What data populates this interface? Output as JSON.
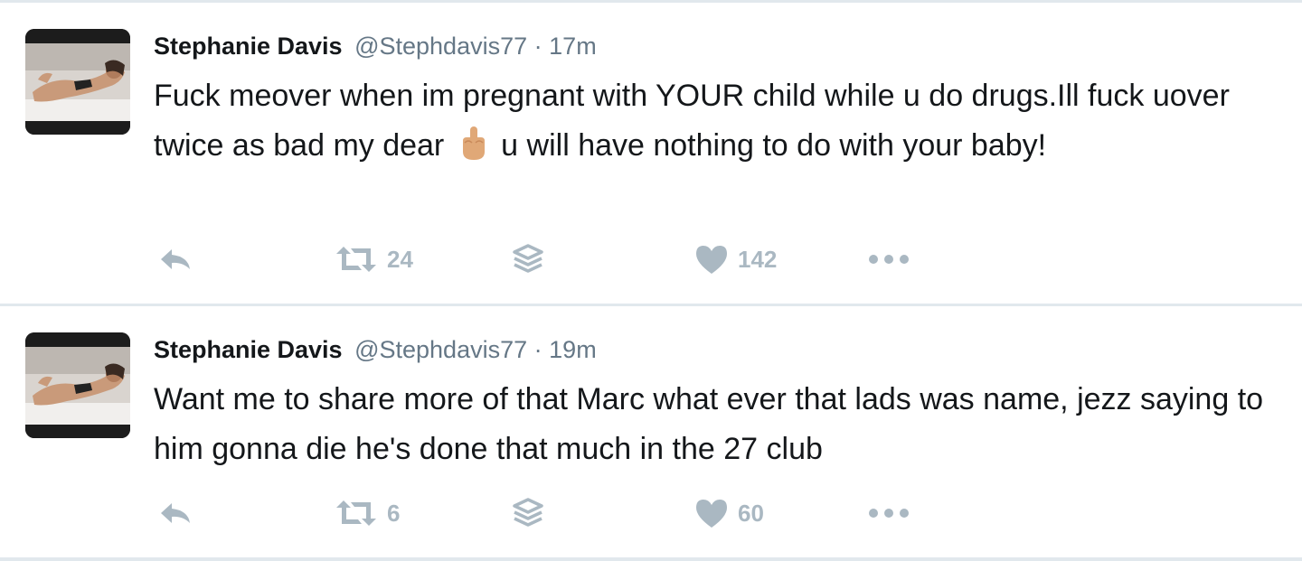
{
  "tweets": [
    {
      "author": {
        "name": "Stephanie Davis",
        "handle": "@Stephdavis77"
      },
      "separator": "·",
      "time": "17m",
      "text_before_emoji": "Fuck meover when im pregnant with YOUR child while u do drugs.Ill fuck uover twice as bad my dear",
      "emoji": "middle-finger-emoji",
      "text_after_emoji": "u will have nothing to do with your baby!",
      "retweets": "24",
      "likes": "142"
    },
    {
      "author": {
        "name": "Stephanie Davis",
        "handle": "@Stephdavis77"
      },
      "separator": "·",
      "time": "19m",
      "text": "Want me to share more of that Marc what ever that lads was name, jezz saying to him gonna die he's done that much in the 27 club",
      "retweets": "6",
      "likes": "60"
    }
  ],
  "colors": {
    "text": "#14171a",
    "secondary": "#657786",
    "icon": "#aab8c2",
    "border": "#e1e8ed"
  },
  "icons": [
    "reply-icon",
    "retweet-icon",
    "stack-icon",
    "heart-icon",
    "more-icon"
  ]
}
